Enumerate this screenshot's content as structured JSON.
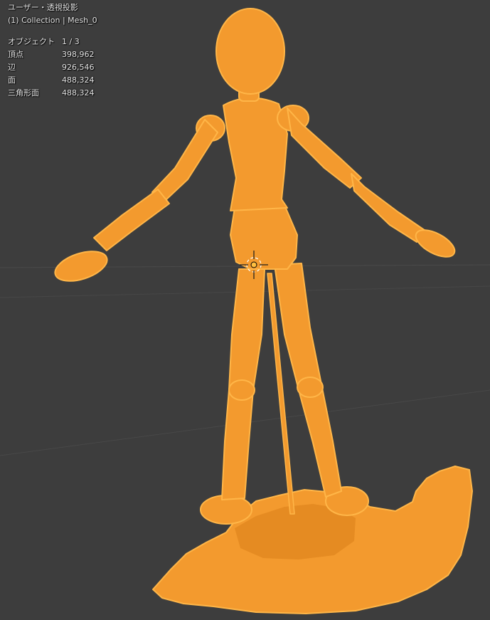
{
  "viewport": {
    "view_label": "ユーザー・透視投影",
    "collection_label": "(1) Collection | Mesh_0"
  },
  "stats": [
    {
      "label": "オブジェクト",
      "value": "1 / 3"
    },
    {
      "label": "頂点",
      "value": "398,962"
    },
    {
      "label": "辺",
      "value": "926,546"
    },
    {
      "label": "面",
      "value": "488,324"
    },
    {
      "label": "三角形面",
      "value": "488,324"
    }
  ],
  "colors": {
    "background": "#3d3d3d",
    "mesh_fill": "#f39a2e",
    "mesh_outline": "#ffb040",
    "mesh_shade": "#d9801c",
    "origin_marker": "#ffbf40"
  },
  "icons": {
    "origin": "origin-marker-icon",
    "cursor": "3d-cursor-icon"
  }
}
